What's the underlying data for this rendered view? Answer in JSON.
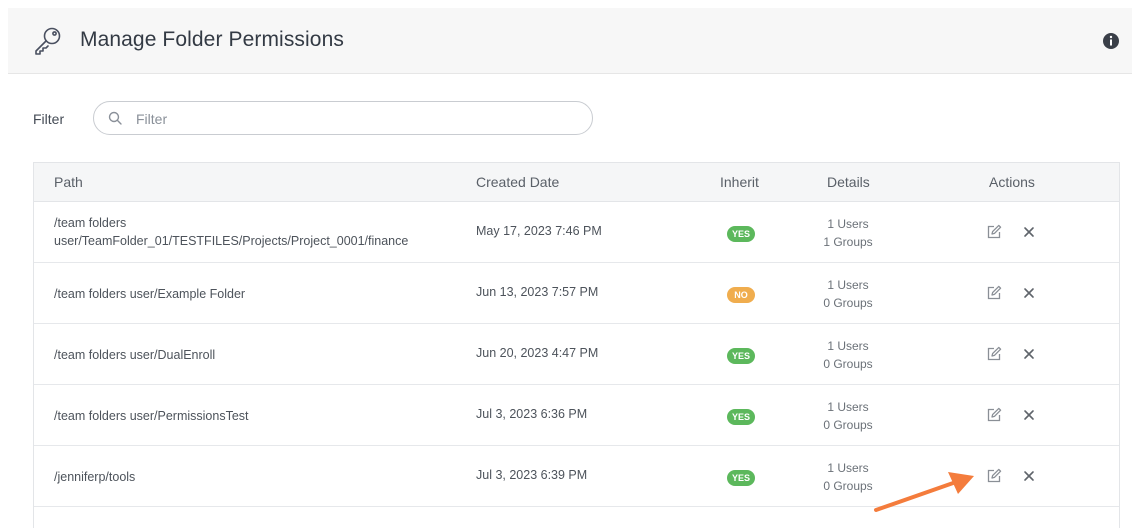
{
  "header": {
    "title": "Manage Folder Permissions",
    "icon": "key-icon",
    "info_icon": "info-icon"
  },
  "filter": {
    "label": "Filter",
    "placeholder": "Filter",
    "value": ""
  },
  "table": {
    "columns": {
      "path": "Path",
      "created": "Created Date",
      "inherit": "Inherit",
      "details": "Details",
      "actions": "Actions"
    },
    "rows": [
      {
        "path_line1": "/team folders",
        "path_line2": "user/TeamFolder_01/TESTFILES/Projects/Project_0001/finance",
        "created": "May 17, 2023 7:46 PM",
        "inherit": "YES",
        "users": "1 Users",
        "groups": "1 Groups"
      },
      {
        "path_line1": "/team folders user/Example Folder",
        "path_line2": "",
        "created": "Jun 13, 2023 7:57 PM",
        "inherit": "NO",
        "users": "1 Users",
        "groups": "0 Groups"
      },
      {
        "path_line1": "/team folders user/DualEnroll",
        "path_line2": "",
        "created": "Jun 20, 2023 4:47 PM",
        "inherit": "YES",
        "users": "1 Users",
        "groups": "0 Groups"
      },
      {
        "path_line1": "/team folders user/PermissionsTest",
        "path_line2": "",
        "created": "Jul 3, 2023 6:36 PM",
        "inherit": "YES",
        "users": "1 Users",
        "groups": "0 Groups"
      },
      {
        "path_line1": "/jenniferp/tools",
        "path_line2": "",
        "created": "Jul 3, 2023 6:39 PM",
        "inherit": "YES",
        "users": "1 Users",
        "groups": "0 Groups"
      }
    ]
  },
  "colors": {
    "yes_badge": "#5cb85c",
    "no_badge": "#f0ad4e",
    "annotation_arrow": "#f47c3c"
  }
}
